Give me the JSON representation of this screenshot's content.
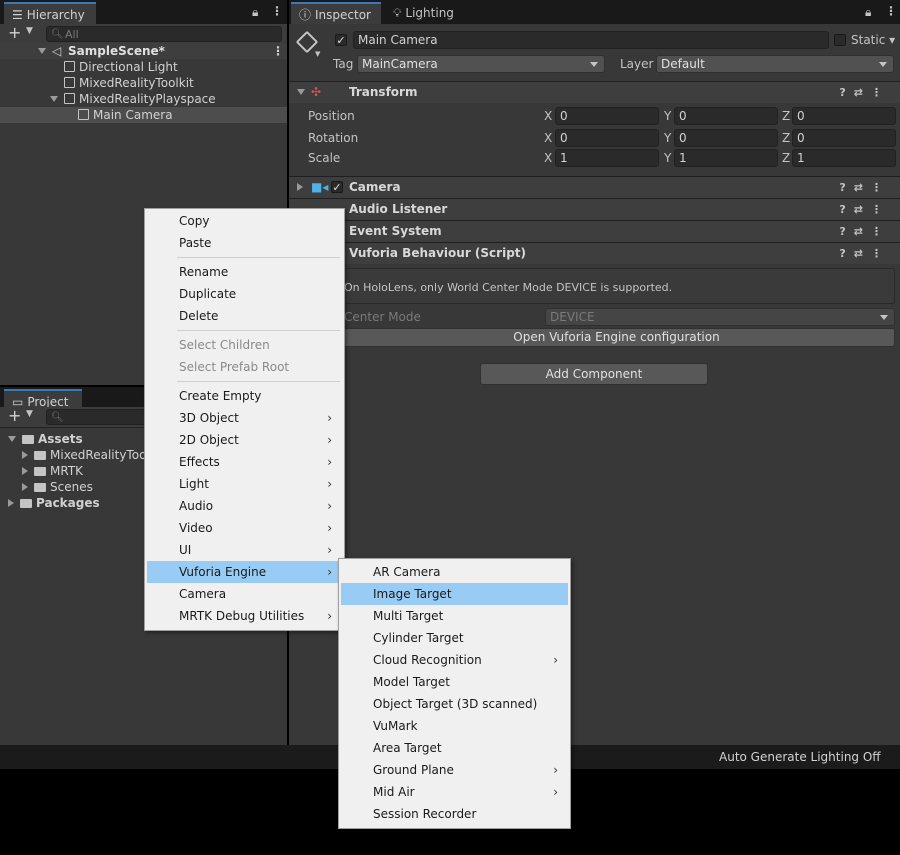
{
  "hierarchy": {
    "tab": "Hierarchy",
    "search_placeholder": "All",
    "scene": "SampleScene*",
    "items": [
      "Directional Light",
      "MixedRealityToolkit",
      "MixedRealityPlayspace",
      "Main Camera"
    ]
  },
  "project": {
    "tab": "Project",
    "assets": "Assets",
    "folders": [
      "MixedRealityToolkit",
      "MRTK",
      "Scenes"
    ],
    "packages": "Packages"
  },
  "inspector": {
    "tab": "Inspector",
    "lighting_tab": "Lighting",
    "object_name": "Main Camera",
    "static_label": "Static",
    "tag_label": "Tag",
    "tag_value": "MainCamera",
    "layer_label": "Layer",
    "layer_value": "Default",
    "transform": {
      "title": "Transform",
      "position_label": "Position",
      "rotation_label": "Rotation",
      "scale_label": "Scale",
      "position": [
        "0",
        "0",
        "0"
      ],
      "rotation": [
        "0",
        "0",
        "0"
      ],
      "scale": [
        "1",
        "1",
        "1"
      ],
      "axis": [
        "X",
        "Y",
        "Z"
      ]
    },
    "components": [
      "Camera",
      "Audio Listener",
      "Event System",
      "Vuforia Behaviour (Script)"
    ],
    "vuforia_info": "On HoloLens, only World Center Mode DEVICE is supported.",
    "center_mode_label": "Center Mode",
    "center_mode_value": "DEVICE",
    "open_config_button": "Open Vuforia Engine configuration",
    "add_component_button": "Add Component"
  },
  "context_menu": {
    "group1": [
      "Copy",
      "Paste"
    ],
    "group2": [
      "Rename",
      "Duplicate",
      "Delete"
    ],
    "group3": [
      "Select Children",
      "Select Prefab Root"
    ],
    "group4": [
      "Create Empty",
      "3D Object",
      "2D Object",
      "Effects",
      "Light",
      "Audio",
      "Video",
      "UI",
      "Vuforia Engine",
      "Camera",
      "MRTK Debug Utilities"
    ],
    "submenu_arrow": "›"
  },
  "vuforia_submenu": {
    "items": [
      "AR Camera",
      "Image Target",
      "Multi Target",
      "Cylinder Target",
      "Cloud Recognition",
      "Model Target",
      "Object Target (3D scanned)",
      "VuMark",
      "Area Target",
      "Ground Plane",
      "Mid Air",
      "Session Recorder"
    ],
    "highlighted": "Image Target"
  },
  "status_bar": {
    "text": "Auto Generate Lighting Off"
  },
  "colors": {
    "panel": "#383838",
    "menu_bg": "#f0f0f0",
    "menu_highlight": "#99ccf5",
    "selected_row": "#4d4d4d"
  }
}
